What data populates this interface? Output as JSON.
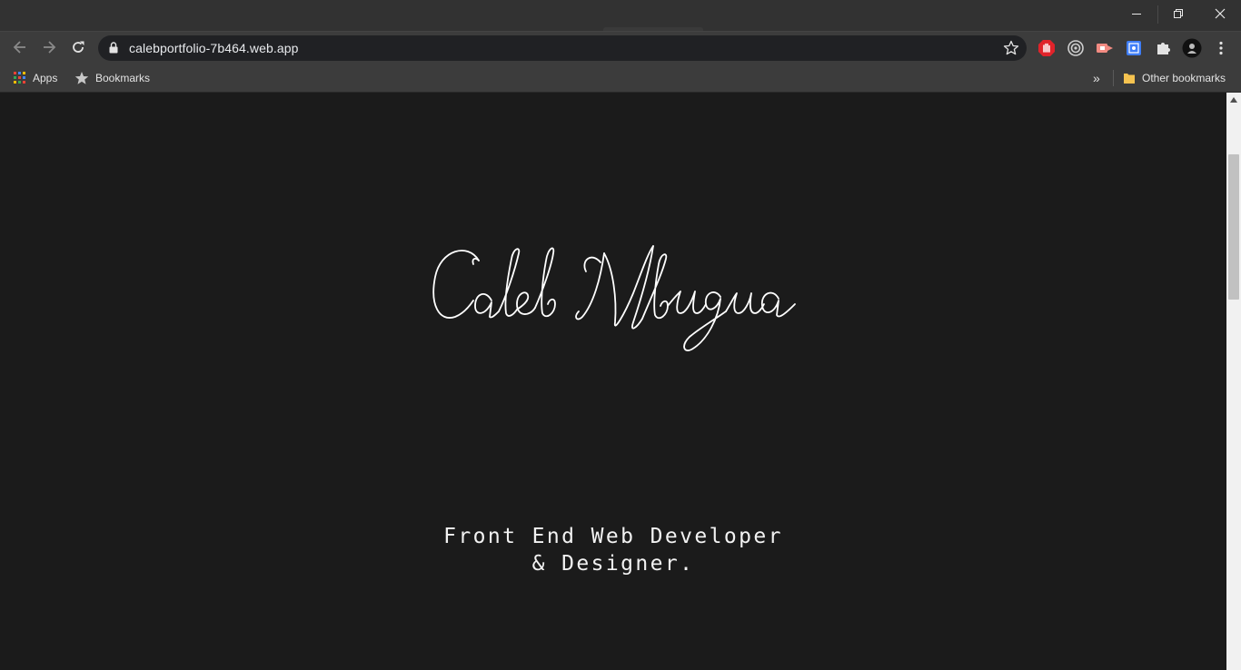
{
  "browser": {
    "url": "calebportfolio-7b464.web.app",
    "bookmarks_bar": {
      "apps_label": "Apps",
      "bookmarks_label": "Bookmarks",
      "other_bookmarks_label": "Other bookmarks",
      "overflow_label": "»"
    },
    "window_controls": [
      "minimize",
      "restore",
      "close"
    ],
    "extensions": [
      "adblock-icon",
      "circle-target-icon",
      "screen-share-icon",
      "blue-box-icon",
      "puzzle-icon"
    ]
  },
  "page": {
    "logo_text": "Caleb Mbugua",
    "subtitle_line1": "Front End Web Developer",
    "subtitle_line2": "& Designer."
  },
  "colors": {
    "page_background": "#1b1b1b",
    "text": "#f2f2f2",
    "toolbar": "#3c3c3c",
    "omnibox": "#202124"
  }
}
